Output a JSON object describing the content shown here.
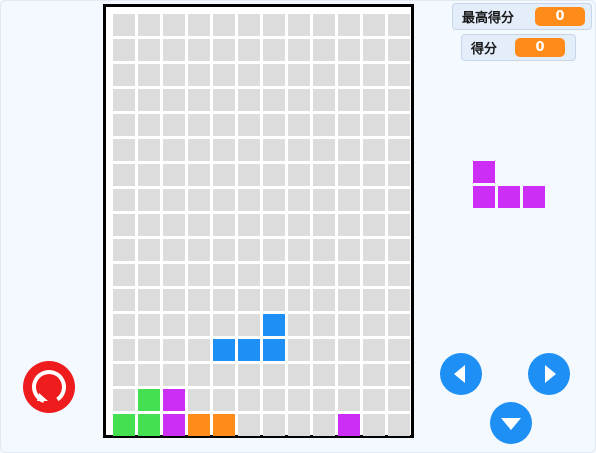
{
  "scoreboard": {
    "best_label": "最高得分",
    "best_value": "0",
    "score_label": "得分",
    "score_value": "0"
  },
  "board": {
    "columns": 12,
    "rows": 17,
    "empty_color": "#dcdcdc",
    "filled_cells": [
      {
        "row": 12,
        "col": 6,
        "color": "#1e8ff5"
      },
      {
        "row": 13,
        "col": 4,
        "color": "#1e8ff5"
      },
      {
        "row": 13,
        "col": 5,
        "color": "#1e8ff5"
      },
      {
        "row": 13,
        "col": 6,
        "color": "#1e8ff5"
      },
      {
        "row": 15,
        "col": 1,
        "color": "#44e052"
      },
      {
        "row": 15,
        "col": 2,
        "color": "#cc2ef5"
      },
      {
        "row": 16,
        "col": 0,
        "color": "#44e052"
      },
      {
        "row": 16,
        "col": 1,
        "color": "#44e052"
      },
      {
        "row": 16,
        "col": 2,
        "color": "#cc2ef5"
      },
      {
        "row": 16,
        "col": 3,
        "color": "#ff8c1a"
      },
      {
        "row": 16,
        "col": 4,
        "color": "#ff8c1a"
      },
      {
        "row": 16,
        "col": 9,
        "color": "#cc2ef5"
      }
    ]
  },
  "next_piece": {
    "color": "#cc2ef5",
    "cells": [
      {
        "row": 0,
        "col": 0
      },
      {
        "row": 1,
        "col": 0
      },
      {
        "row": 1,
        "col": 1
      },
      {
        "row": 1,
        "col": 2
      }
    ]
  },
  "controls": {
    "accent_color": "#1e8ff5",
    "restart_color": "#ee1c1c",
    "icons": [
      "restart-icon",
      "arrow-left-icon",
      "arrow-right-icon",
      "arrow-down-icon"
    ]
  }
}
